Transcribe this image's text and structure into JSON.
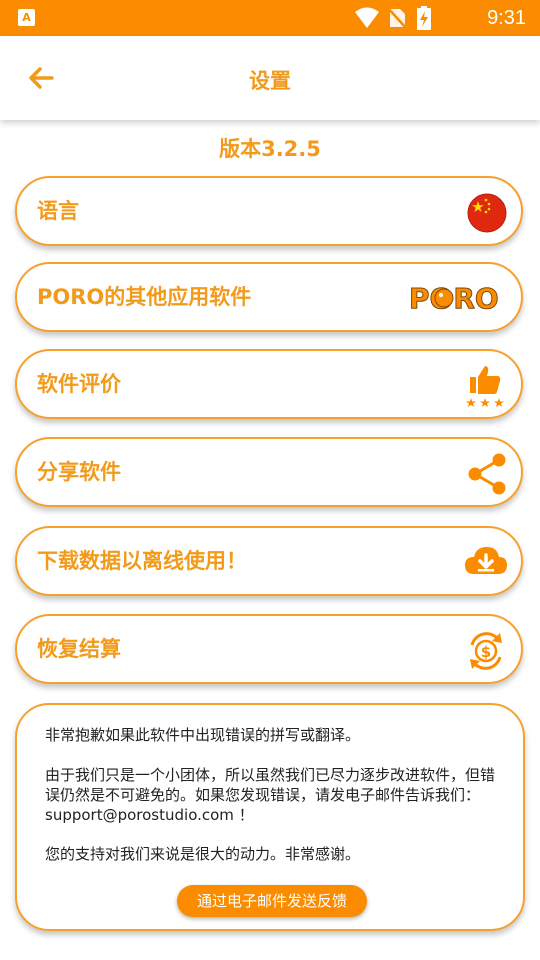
{
  "status_bar": {
    "app_badge": "A",
    "time": "9:31",
    "icons": [
      "wifi-icon",
      "no-sim-icon",
      "battery-charging-icon"
    ]
  },
  "app_bar": {
    "title": "设置",
    "back_icon": "arrow-left-icon"
  },
  "version": "版本3.2.5",
  "menu": [
    {
      "label": "语言",
      "icon": "china-flag-icon"
    },
    {
      "label": "PORO的其他应用软件",
      "icon": "poro-logo-icon"
    },
    {
      "label": "软件评价",
      "icon": "thumbs-up-stars-icon"
    },
    {
      "label": "分享软件",
      "icon": "share-icon"
    },
    {
      "label": "下载数据以离线使用！",
      "icon": "cloud-download-icon"
    },
    {
      "label": "恢复结算",
      "icon": "restore-purchase-icon"
    }
  ],
  "notice": {
    "line1": "非常抱歉如果此软件中出现错误的拼写或翻译。",
    "line2": "由于我们只是一个小团体，所以虽然我们已尽力逐步改进软件，但错误仍然是不可避免的。如果您发现错误，请发电子邮件告诉我们：",
    "email": "support@porostudio.com",
    "line2_end": " ！",
    "line3": "您的支持对我们来说是很大的动力。非常感谢。",
    "button_label": "通过电子邮件发送反馈"
  },
  "colors": {
    "accent": "#fb8c00",
    "text_accent": "#f29a1a"
  },
  "logo_text": "PORO"
}
